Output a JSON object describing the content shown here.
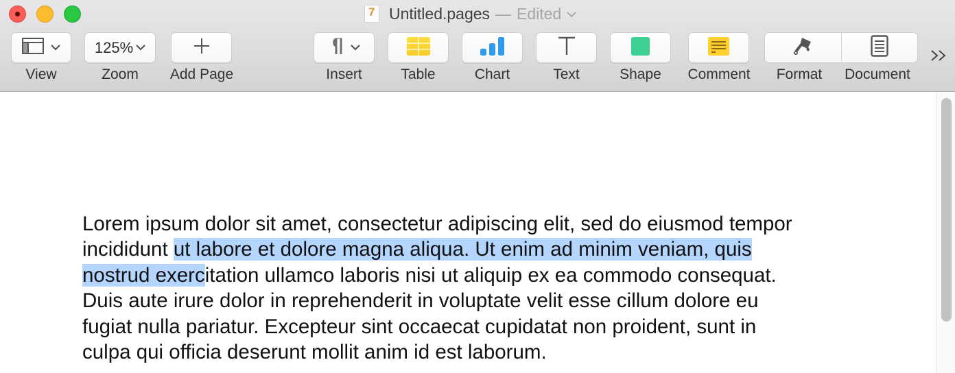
{
  "window": {
    "title": "Untitled.pages",
    "separator": "—",
    "status": "Edited",
    "traffic_lights": [
      "close",
      "minimize",
      "zoom"
    ]
  },
  "toolbar": {
    "view": {
      "label": "View",
      "icon": "sidebar-layout-icon",
      "has_menu": true
    },
    "zoom": {
      "label": "Zoom",
      "value": "125%",
      "has_menu": true
    },
    "add_page": {
      "label": "Add Page",
      "icon": "plus-icon"
    },
    "insert": {
      "label": "Insert",
      "icon": "pilcrow-icon",
      "has_menu": true
    },
    "table": {
      "label": "Table",
      "icon": "table-icon"
    },
    "chart": {
      "label": "Chart",
      "icon": "bar-chart-icon"
    },
    "text": {
      "label": "Text",
      "icon": "text-box-icon"
    },
    "shape": {
      "label": "Shape",
      "icon": "square-shape-icon"
    },
    "comment": {
      "label": "Comment",
      "icon": "comment-note-icon"
    },
    "format": {
      "label": "Format",
      "icon": "paintbrush-icon"
    },
    "document": {
      "label": "Document",
      "icon": "document-icon"
    },
    "overflow": {
      "symbol": ">>"
    }
  },
  "colors": {
    "selection": "#b4d5fe",
    "table_icon": "#fdd835",
    "chart_icon": "#2f9bea",
    "shape_icon": "#3cd193",
    "comment_icon": "#fecf2f"
  },
  "document": {
    "lines": [
      {
        "before": "Lorem ipsum dolor sit amet, consectetur adipiscing elit, sed do eiusmod tempor",
        "selected": "",
        "after": ""
      },
      {
        "before": "incididunt ",
        "selected": "ut labore et dolore magna aliqua. Ut enim ad minim veniam, quis ",
        "after": ""
      },
      {
        "before": "",
        "selected": "nostrud exerc",
        "after": "itation ullamco laboris nisi ut aliquip ex ea commodo consequat."
      },
      {
        "before": "Duis aute irure dolor in reprehenderit in voluptate velit esse cillum dolore eu",
        "selected": "",
        "after": ""
      },
      {
        "before": "fugiat nulla pariatur. Excepteur sint occaecat cupidatat non proident, sunt in",
        "selected": "",
        "after": ""
      },
      {
        "before": "culpa qui officia deserunt mollit anim id est laborum.",
        "selected": "",
        "after": ""
      }
    ],
    "selected_text": "ut labore et dolore magna aliqua. Ut enim ad minim veniam, quis nostrud exerc"
  },
  "scrollbar": {
    "visible_fraction": 0.83,
    "position": 0.0
  }
}
